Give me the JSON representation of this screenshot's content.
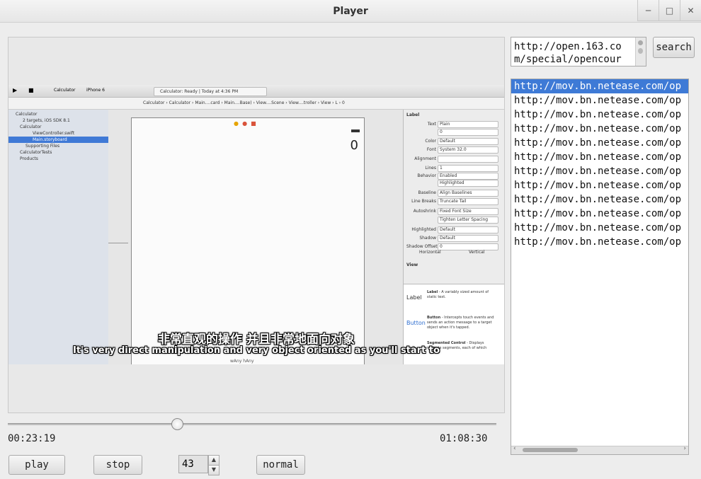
{
  "window": {
    "title": "Player",
    "controls": [
      "minimize",
      "maximize",
      "close"
    ]
  },
  "video": {
    "toolbar": {
      "scheme": "Calculator",
      "device": "iPhone 6",
      "status": "Calculator: Ready  |  Today at 4:36 PM"
    },
    "breadcrumb": [
      "Calculator",
      "Calculator",
      "Main....card",
      "Main....Base)",
      "View....Scene",
      "View....troller",
      "View",
      "L",
      "0"
    ],
    "navigator": [
      "Calculator",
      "2 targets, iOS SDK 8.1",
      "Calculator",
      "ViewController.swift",
      "Main.storyboard",
      "Supporting Files",
      "CalculatorTests",
      "Products"
    ],
    "inspector": {
      "section": "Label",
      "rows": [
        {
          "label": "Text",
          "value": "Plain"
        },
        {
          "label": "",
          "value": "0"
        },
        {
          "label": "Color",
          "value": "Default"
        },
        {
          "label": "Font",
          "value": "System 32.0"
        },
        {
          "label": "Alignment",
          "value": ""
        },
        {
          "label": "Lines",
          "value": "1"
        },
        {
          "label": "Behavior",
          "value": "Enabled"
        },
        {
          "label": "",
          "value": "Highlighted"
        },
        {
          "label": "Baseline",
          "value": "Align Baselines"
        },
        {
          "label": "Line Breaks",
          "value": "Truncate Tail"
        },
        {
          "label": "Autoshrink",
          "value": "Fixed Font Size"
        },
        {
          "label": "",
          "value": "Tighten Letter Spacing"
        },
        {
          "label": "Highlighted",
          "value": "Default"
        },
        {
          "label": "Shadow",
          "value": "Default"
        },
        {
          "label": "Shadow Offset",
          "value": "0"
        }
      ],
      "offset_labels": [
        "Horizontal",
        "Vertical"
      ],
      "view_section": "View",
      "library": [
        {
          "icon": "Label",
          "title": "Label",
          "desc": "A variably sized amount of static text."
        },
        {
          "icon": "Button",
          "title": "Button",
          "desc": "Intercepts touch events and sends an action message to a target object when it's tapped."
        },
        {
          "icon": "1 2",
          "title": "Segmented Control",
          "desc": "Displays multiple segments, each of which"
        }
      ]
    },
    "scene_label_value": "0",
    "size_class": "wAny hAny",
    "subtitle_cn": "非常直观的操作 并且非常地面向对象",
    "subtitle_en": "It's very direct manipulation and very object oriented as you'll start to"
  },
  "playback": {
    "progress": 0.3399,
    "elapsed": "00:23:19",
    "total": "01:08:30"
  },
  "controls": {
    "play_label": "play",
    "stop_label": "stop",
    "volume": "43",
    "speed_label": "normal"
  },
  "url_field": {
    "value": "http://open.163.com/special/opencour"
  },
  "search_label": "search",
  "playlist": [
    "http://mov.bn.netease.com/op",
    "http://mov.bn.netease.com/op",
    "http://mov.bn.netease.com/op",
    "http://mov.bn.netease.com/op",
    "http://mov.bn.netease.com/op",
    "http://mov.bn.netease.com/op",
    "http://mov.bn.netease.com/op",
    "http://mov.bn.netease.com/op",
    "http://mov.bn.netease.com/op",
    "http://mov.bn.netease.com/op",
    "http://mov.bn.netease.com/op",
    "http://mov.bn.netease.com/op"
  ],
  "playlist_selected": 0,
  "colors": {
    "selection": "#3e7ad6",
    "window_bg": "#ededed"
  }
}
